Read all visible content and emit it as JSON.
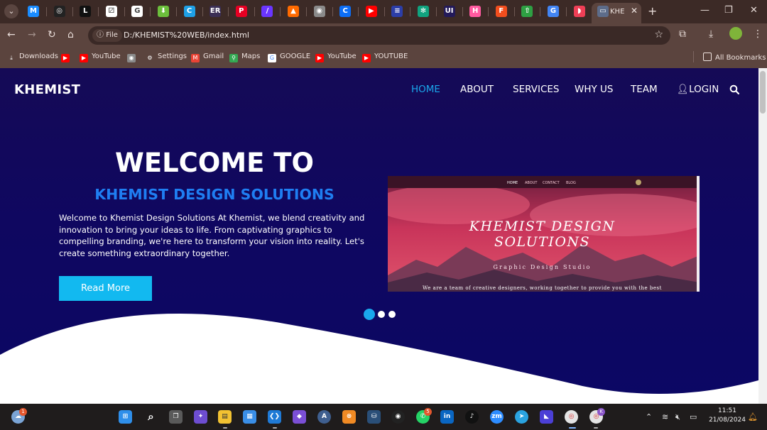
{
  "browser": {
    "tabs": [
      {
        "icon": "medium-icon",
        "glyph": "M",
        "color": "#1a8cff"
      },
      {
        "icon": "openai-icon",
        "glyph": "◎",
        "color": "#222222"
      },
      {
        "icon": "letter-l-icon",
        "glyph": "L",
        "color": "#111111"
      },
      {
        "icon": "dice-icon",
        "glyph": "⚂",
        "color": "#ffffff"
      },
      {
        "icon": "google-icon",
        "glyph": "G",
        "color": "#ffffff"
      },
      {
        "icon": "download-arrow-icon",
        "glyph": "⬇",
        "color": "#6cbf3c"
      },
      {
        "icon": "canva-icon",
        "glyph": "C",
        "color": "#1ea0e6"
      },
      {
        "icon": "er-icon",
        "glyph": "ER",
        "color": "#3b2f55"
      },
      {
        "icon": "pinterest-icon",
        "glyph": "P",
        "color": "#e60023"
      },
      {
        "icon": "feather-icon",
        "glyph": "/",
        "color": "#6a35ff"
      },
      {
        "icon": "fire-icon",
        "glyph": "▲",
        "color": "#ff6a00"
      },
      {
        "icon": "globe-icon",
        "glyph": "◉",
        "color": "#8a8a8a"
      },
      {
        "icon": "c-brand-icon",
        "glyph": "C",
        "color": "#0c6ef5"
      },
      {
        "icon": "youtube-icon",
        "glyph": "▶",
        "color": "#ff0000"
      },
      {
        "icon": "bar-chart-icon",
        "glyph": "≡",
        "color": "#2c3ea8"
      },
      {
        "icon": "chatgpt-icon",
        "glyph": "✻",
        "color": "#10a37f"
      },
      {
        "icon": "ui-icon",
        "glyph": "UI",
        "color": "#231a5a"
      },
      {
        "icon": "h-brand-icon",
        "glyph": "H",
        "color": "#ff5aa0"
      },
      {
        "icon": "figma-icon",
        "glyph": "F",
        "color": "#f24e1e"
      },
      {
        "icon": "up-arrow-icon",
        "glyph": "⇧",
        "color": "#2ea043"
      },
      {
        "icon": "translate-icon",
        "glyph": "G",
        "color": "#4285f4"
      },
      {
        "icon": "pocket-icon",
        "glyph": "◗",
        "color": "#ef3f56"
      }
    ],
    "active_tab": {
      "title": "KHE",
      "icon": "page-icon"
    },
    "address": {
      "chip": "File",
      "url": "D:/KHEMIST%20WEB/index.html"
    },
    "bookmarks": [
      {
        "label": "Downloads",
        "icon": "download-icon",
        "color": "#5b443e"
      },
      {
        "label": "",
        "icon": "youtube-icon",
        "color": "#ff0000"
      },
      {
        "label": "YouTube",
        "icon": "youtube-icon",
        "color": "#ff0000"
      },
      {
        "label": "",
        "icon": "globe-icon",
        "color": "#8a8a8a"
      },
      {
        "label": "Settings",
        "icon": "gear-icon",
        "color": "#5b443e"
      },
      {
        "label": "Gmail",
        "icon": "gmail-icon",
        "color": "#ea4335"
      },
      {
        "label": "Maps",
        "icon": "maps-pin-icon",
        "color": "#34a853"
      },
      {
        "label": "GOOGLE",
        "icon": "google-icon",
        "color": "#ffffff"
      },
      {
        "label": "YouTube",
        "icon": "youtube-icon",
        "color": "#ff0000"
      },
      {
        "label": "YOUTUBE",
        "icon": "youtube-icon",
        "color": "#ff0000"
      }
    ],
    "all_bookmarks": "All Bookmarks"
  },
  "site": {
    "brand": "KHEMIST",
    "nav": [
      "HOME",
      "ABOUT",
      "SERVICES",
      "WHY US",
      "TEAM"
    ],
    "login": "LOGIN",
    "heading": "WELCOME TO",
    "subheading": "KHEMIST DESIGN SOLUTIONS",
    "intro": "Welcome to Khemist Design Solutions At Khemist, we blend creativity and innovation to bring your ideas to life. From captivating graphics to compelling branding, we're here to transform your vision into reality. Let's create something extraordinary together.",
    "cta": "Read More",
    "accent": "#1aa7ec",
    "slider_active_color": "#1aa7ec",
    "slides_total": 3,
    "slide_active": 1,
    "preview": {
      "nav": [
        "HOME",
        "ABOUT",
        "CONTACT",
        "BLOG"
      ],
      "title_line1": "KHEMIST DESIGN",
      "title_line2": "SOLUTIONS",
      "subtitle": "Graphic Design Studio",
      "tagline": "We are a team of creative designers, working together to provide you with the best"
    }
  },
  "taskbar": {
    "weather_badge": "1",
    "whatsapp_badge": "5",
    "chrome_profile_badge": "K",
    "time": "11:51",
    "date": "21/08/2024"
  }
}
